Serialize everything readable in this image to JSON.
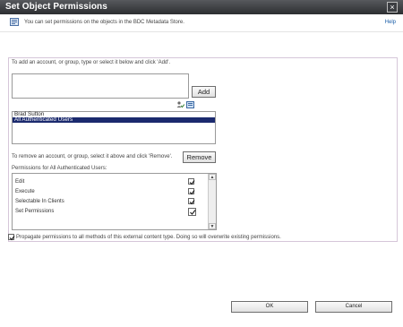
{
  "window": {
    "title": "Set Object Permissions",
    "close_glyph": "×"
  },
  "info_bar": {
    "icon": "permissions-info-icon",
    "text": "You can set permissions on the objects in the BDC Metadata Store.",
    "help_label": "Help"
  },
  "add_section": {
    "instruction": "To add an account, or group, type or select it below and click 'Add'.",
    "input_value": "",
    "add_label": "Add",
    "icons": [
      "check-names-icon",
      "browse-directory-icon"
    ]
  },
  "user_list": {
    "items": [
      {
        "label": "Brad Sutton",
        "selected": false
      },
      {
        "label": "All Authenticated Users",
        "selected": true
      }
    ]
  },
  "remove_section": {
    "instruction": "To remove an account, or group, select it above and click 'Remove'.",
    "remove_label": "Remove"
  },
  "permissions": {
    "label": "Permissions for All Authenticated Users:",
    "items": [
      {
        "label": "Edit",
        "checked": true
      },
      {
        "label": "Execute",
        "checked": true
      },
      {
        "label": "Selectable In Clients",
        "checked": true
      },
      {
        "label": "Set Permissions",
        "checked": true
      }
    ]
  },
  "propagate": {
    "checked": true,
    "label": "Propagate permissions to all methods of this external content type. Doing so will overwrite existing permissions."
  },
  "footer": {
    "ok_label": "OK",
    "cancel_label": "Cancel"
  }
}
